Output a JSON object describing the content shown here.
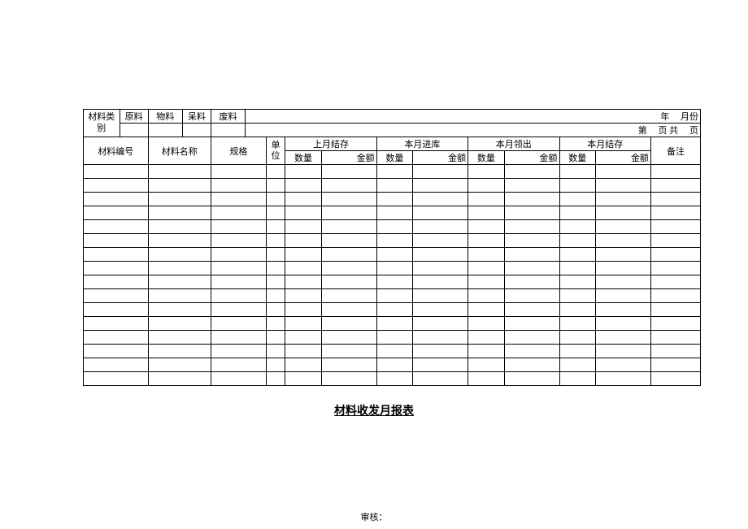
{
  "header": {
    "material_category_label": "材料类别",
    "cat_raw": "原料",
    "cat_goods": "物料",
    "cat_stagnant": "呆料",
    "cat_waste": "废料",
    "year_label": "年",
    "month_label": "月份",
    "page_prefix": "第",
    "page_mid": "页 共",
    "page_suffix": "页"
  },
  "columns": {
    "material_no": "材料编号",
    "material_name": "材料名称",
    "spec": "规格",
    "unit": "单位",
    "last_month_balance": "上月结存",
    "this_month_in": "本月进库",
    "this_month_out": "本月领出",
    "this_month_balance": "本月结存",
    "remark": "备注",
    "qty": "数量",
    "amount": "金额"
  },
  "title": "材料收发月报表",
  "footer": {
    "audit": "审核："
  },
  "data_rows": 16
}
